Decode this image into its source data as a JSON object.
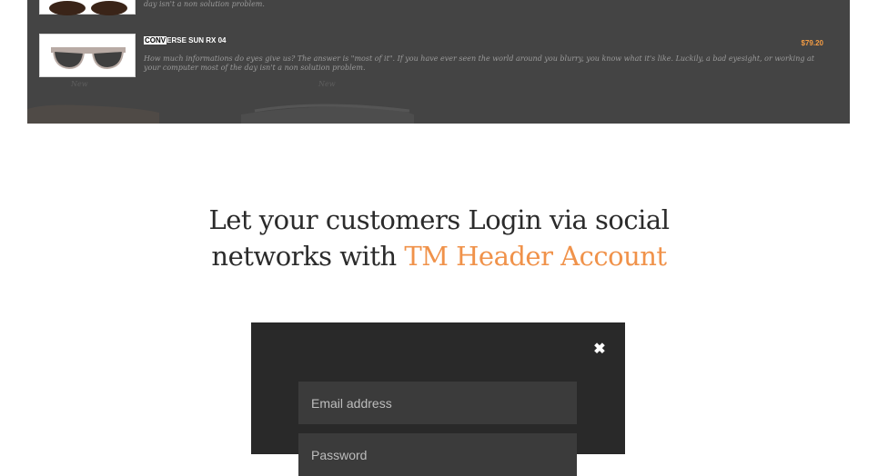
{
  "preview": {
    "product_top": {
      "description_tail": "day isn't a non solution problem."
    },
    "product_main": {
      "title_highlight": "CONV",
      "title_rest": "ERSE SUN RX 04",
      "price": "$79.20",
      "description": "How much informations do eyes give us? The answer is \"most of it\". If you have ever seen the world around you blurry, you know what it's like. Luckily, a bad eyesight, or working at your computer most of the day isn't a non solution problem."
    },
    "new_labels": [
      "New",
      "New"
    ]
  },
  "headline": {
    "line1": "Let your customers Login via social",
    "line2_prefix": "networks with ",
    "line2_accent": "TM Header Account"
  },
  "modal": {
    "close_symbol": "✖",
    "email_placeholder": "Email address",
    "password_placeholder": "Password"
  },
  "colors": {
    "accent": "#f0924a",
    "price": "#f39c44",
    "modal_bg": "#292929",
    "field_bg": "#3b3b3b"
  }
}
